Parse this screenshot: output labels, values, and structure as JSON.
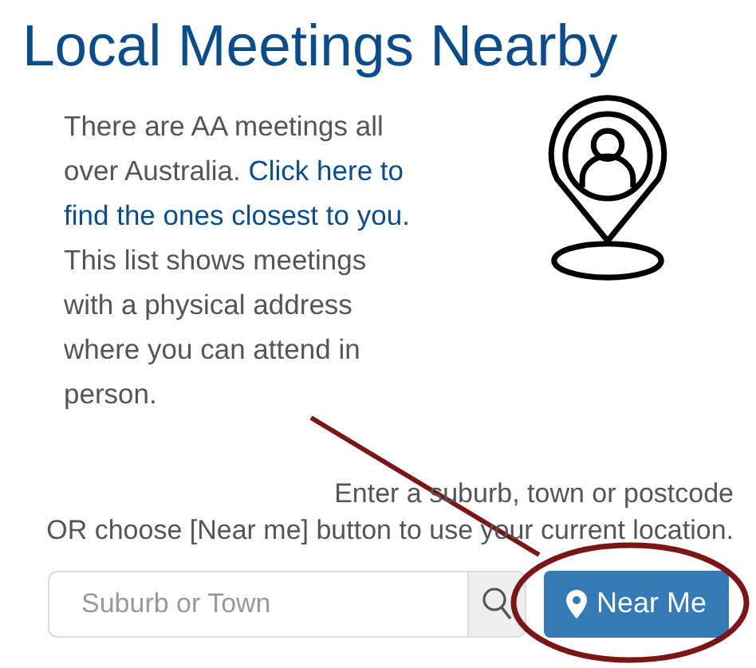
{
  "title": "Local Meetings Nearby",
  "intro_lines": [
    [
      {
        "kind": "text",
        "text": "There are AA meetings all"
      }
    ],
    [
      {
        "kind": "text",
        "text": "over Australia."
      },
      {
        "kind": "link",
        "text": "Click here to"
      }
    ],
    [
      {
        "kind": "link",
        "text": "find the ones closest to you."
      }
    ],
    [
      {
        "kind": "text",
        "text": "This list shows meetings"
      }
    ],
    [
      {
        "kind": "text",
        "text": "with a physical address"
      }
    ],
    [
      {
        "kind": "text",
        "text": "where you can attend in"
      }
    ],
    [
      {
        "kind": "text",
        "text": "person."
      }
    ]
  ],
  "instructions": [
    "Enter a suburb, town or postcode",
    "OR choose [Near me] button to use your current location."
  ],
  "search": {
    "placeholder": "Suburb or Town"
  },
  "near_me_button": {
    "label": "Near Me"
  }
}
